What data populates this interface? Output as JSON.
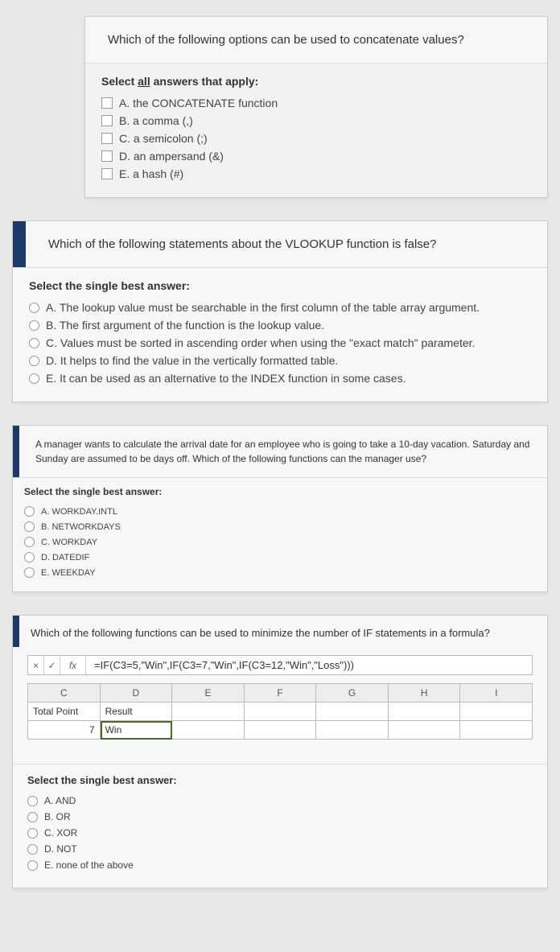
{
  "q1": {
    "prompt": "Which of the following options can be used to concatenate values?",
    "instruction_prefix": "Select ",
    "instruction_underlined": "all",
    "instruction_suffix": " answers that apply:",
    "options": [
      "A. the CONCATENATE function",
      "B. a comma (,)",
      "C. a semicolon (;)",
      "D. an ampersand (&)",
      "E. a hash (#)"
    ]
  },
  "q2": {
    "prompt": "Which of the following statements about the VLOOKUP function is false?",
    "instruction": "Select the single best answer:",
    "options": [
      "A. The lookup value must be searchable in the first column of the table array argument.",
      "B. The first argument of the function is the lookup value.",
      "C. Values must be sorted in ascending order when using the \"exact match\" parameter.",
      "D. It helps to find the value in the vertically formatted table.",
      "E. It can be used as an alternative to the INDEX function in some cases."
    ]
  },
  "q3": {
    "prompt": "A manager wants to calculate the arrival date for an employee who is going to take a 10-day vacation. Saturday and Sunday are assumed to be days off. Which of the following functions can the manager use?",
    "instruction": "Select the single best answer:",
    "options": [
      "A. WORKDAY.INTL",
      "B. NETWORKDAYS",
      "C. WORKDAY",
      "D. DATEDIF",
      "E. WEEKDAY"
    ]
  },
  "q4": {
    "prompt": "Which of the following functions can be used to minimize the number of IF statements in a formula?",
    "instruction": "Select the single best answer:",
    "options": [
      "A. AND",
      "B. OR",
      "C. XOR",
      "D. NOT",
      "E. none of the above"
    ],
    "chart_data": {
      "type": "table",
      "fx_label": "fx",
      "formula": "=IF(C3=5,\"Win\",IF(C3=7,\"Win\",IF(C3=12,\"Win\",\"Loss\")))",
      "columns": [
        "C",
        "D",
        "E",
        "F",
        "G",
        "H",
        "I"
      ],
      "rows": [
        [
          "Total Point",
          "Result",
          "",
          "",
          "",
          "",
          ""
        ],
        [
          "7",
          "Win",
          "",
          "",
          "",
          "",
          ""
        ]
      ]
    }
  }
}
